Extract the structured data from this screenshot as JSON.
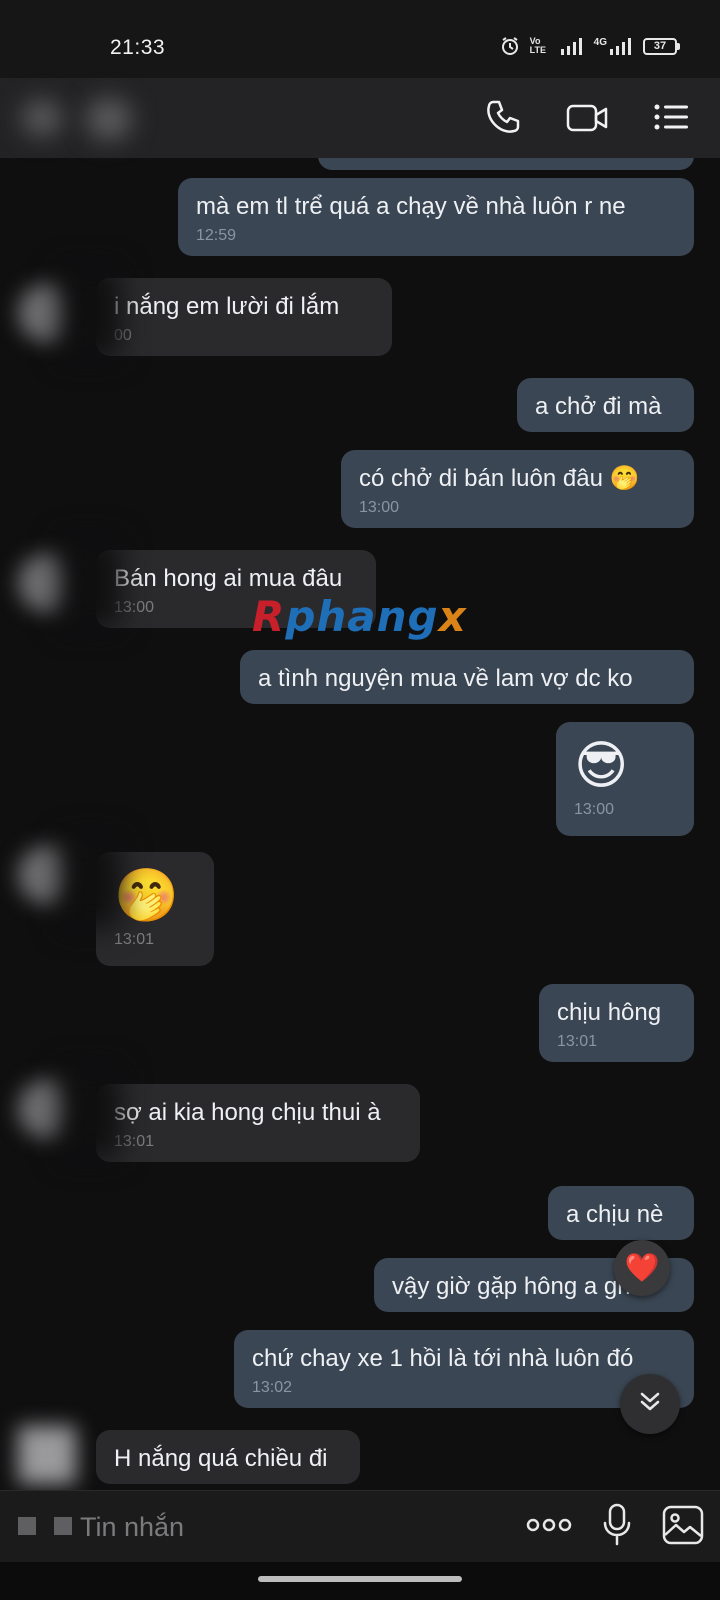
{
  "status_bar": {
    "time": "21:33",
    "network_label": "4G",
    "volte_label": "Vo LTE",
    "battery": "37"
  },
  "header": {
    "icons": [
      "phone-icon",
      "video-call-icon",
      "menu-list-icon"
    ]
  },
  "messages": [
    {
      "id": "m1",
      "direction": "outgoing",
      "text": "mà em tl trể quá a chạy về nhà luôn r ne",
      "time": "12:59"
    },
    {
      "id": "m2",
      "direction": "incoming",
      "text": "i nắng em lười đi lắm",
      "time": "00"
    },
    {
      "id": "m3",
      "direction": "outgoing",
      "text": "a chở đi mà",
      "time": ""
    },
    {
      "id": "m4",
      "direction": "outgoing",
      "text": "có chở di bán luôn đâu 🤭",
      "time": "13:00"
    },
    {
      "id": "m5",
      "direction": "incoming",
      "text": "Bán hong ai mua đâu",
      "time": "13:00"
    },
    {
      "id": "m6",
      "direction": "outgoing",
      "text": "a tình nguyện mua về lam vợ dc ko",
      "time": ""
    },
    {
      "id": "m7",
      "direction": "outgoing",
      "text": "😎",
      "time": "13:00"
    },
    {
      "id": "m8",
      "direction": "incoming",
      "text": "🤭",
      "time": "13:01"
    },
    {
      "id": "m9",
      "direction": "outgoing",
      "text": "chịu hông",
      "time": "13:01"
    },
    {
      "id": "m10",
      "direction": "incoming",
      "text": "sợ ai kia hong chịu thui à",
      "time": "13:01"
    },
    {
      "id": "m11",
      "direction": "outgoing",
      "text": "a chịu nè",
      "time": ""
    },
    {
      "id": "m12",
      "direction": "outgoing",
      "text": "vậy giờ gặp hông a ghé",
      "time": ""
    },
    {
      "id": "m13",
      "direction": "outgoing",
      "text": "chứ chay xe 1 hồi là tới nhà luôn đó",
      "time": "13:02"
    },
    {
      "id": "m14",
      "direction": "incoming",
      "text": "H nắng quá chiều đi",
      "time": ""
    }
  ],
  "watermark": {
    "part_a": "R",
    "part_b": "phang",
    "part_c": "x"
  },
  "reaction": {
    "emoji": "❤️"
  },
  "composer": {
    "placeholder": "Tin nhắn",
    "value": "",
    "more_label": "ooo"
  },
  "colors": {
    "background": "#0f0f10",
    "outgoing_bubble": "#3a4653",
    "incoming_bubble": "#2a2a2c",
    "header": "#232325"
  }
}
